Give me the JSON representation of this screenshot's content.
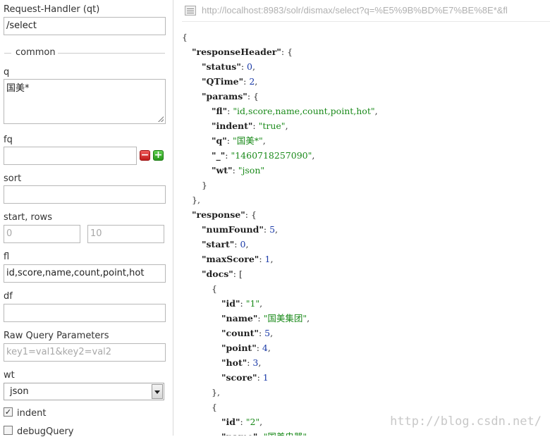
{
  "form": {
    "request_handler": {
      "label": "Request-Handler (qt)",
      "value": "/select"
    },
    "common_legend": "common",
    "q": {
      "label": "q",
      "value": "国美*"
    },
    "fq": {
      "label": "fq",
      "value": ""
    },
    "sort": {
      "label": "sort",
      "value": ""
    },
    "start_rows": {
      "label": "start, rows",
      "start_placeholder": "0",
      "rows_placeholder": "10"
    },
    "fl": {
      "label": "fl",
      "value": "id,score,name,count,point,hot"
    },
    "df": {
      "label": "df",
      "value": ""
    },
    "raw": {
      "label": "Raw Query Parameters",
      "placeholder": "key1=val1&key2=val2"
    },
    "wt": {
      "label": "wt",
      "value": "json"
    },
    "indent": {
      "label": "indent",
      "checked": true
    },
    "debug": {
      "label": "debugQuery",
      "checked": false
    }
  },
  "result": {
    "url": "http://localhost:8983/solr/dismax/select?q=%E5%9B%BD%E7%BE%8E*&fl",
    "lines": [
      {
        "indent": 0,
        "parts": [
          {
            "t": "p",
            "v": "{"
          }
        ]
      },
      {
        "indent": 1,
        "parts": [
          {
            "t": "k",
            "v": "\"responseHeader\""
          },
          {
            "t": "p",
            "v": ": {"
          }
        ]
      },
      {
        "indent": 2,
        "parts": [
          {
            "t": "k",
            "v": "\"status\""
          },
          {
            "t": "p",
            "v": ": "
          },
          {
            "t": "n",
            "v": "0"
          },
          {
            "t": "p",
            "v": ","
          }
        ]
      },
      {
        "indent": 2,
        "parts": [
          {
            "t": "k",
            "v": "\"QTime\""
          },
          {
            "t": "p",
            "v": ": "
          },
          {
            "t": "n",
            "v": "2"
          },
          {
            "t": "p",
            "v": ","
          }
        ]
      },
      {
        "indent": 2,
        "parts": [
          {
            "t": "k",
            "v": "\"params\""
          },
          {
            "t": "p",
            "v": ": {"
          }
        ]
      },
      {
        "indent": 3,
        "parts": [
          {
            "t": "k",
            "v": "\"fl\""
          },
          {
            "t": "p",
            "v": ": "
          },
          {
            "t": "s",
            "v": "\"id,score,name,count,point,hot\""
          },
          {
            "t": "p",
            "v": ","
          }
        ]
      },
      {
        "indent": 3,
        "parts": [
          {
            "t": "k",
            "v": "\"indent\""
          },
          {
            "t": "p",
            "v": ": "
          },
          {
            "t": "s",
            "v": "\"true\""
          },
          {
            "t": "p",
            "v": ","
          }
        ]
      },
      {
        "indent": 3,
        "parts": [
          {
            "t": "k",
            "v": "\"q\""
          },
          {
            "t": "p",
            "v": ": "
          },
          {
            "t": "s",
            "v": "\"国美*\""
          },
          {
            "t": "p",
            "v": ","
          }
        ]
      },
      {
        "indent": 3,
        "parts": [
          {
            "t": "k",
            "v": "\"_\""
          },
          {
            "t": "p",
            "v": ": "
          },
          {
            "t": "s",
            "v": "\"1460718257090\""
          },
          {
            "t": "p",
            "v": ","
          }
        ]
      },
      {
        "indent": 3,
        "parts": [
          {
            "t": "k",
            "v": "\"wt\""
          },
          {
            "t": "p",
            "v": ": "
          },
          {
            "t": "s",
            "v": "\"json\""
          }
        ]
      },
      {
        "indent": 2,
        "parts": [
          {
            "t": "p",
            "v": "}"
          }
        ]
      },
      {
        "indent": 1,
        "parts": [
          {
            "t": "p",
            "v": "},"
          }
        ]
      },
      {
        "indent": 1,
        "parts": [
          {
            "t": "k",
            "v": "\"response\""
          },
          {
            "t": "p",
            "v": ": {"
          }
        ]
      },
      {
        "indent": 2,
        "parts": [
          {
            "t": "k",
            "v": "\"numFound\""
          },
          {
            "t": "p",
            "v": ": "
          },
          {
            "t": "n",
            "v": "5"
          },
          {
            "t": "p",
            "v": ","
          }
        ]
      },
      {
        "indent": 2,
        "parts": [
          {
            "t": "k",
            "v": "\"start\""
          },
          {
            "t": "p",
            "v": ": "
          },
          {
            "t": "n",
            "v": "0"
          },
          {
            "t": "p",
            "v": ","
          }
        ]
      },
      {
        "indent": 2,
        "parts": [
          {
            "t": "k",
            "v": "\"maxScore\""
          },
          {
            "t": "p",
            "v": ": "
          },
          {
            "t": "n",
            "v": "1"
          },
          {
            "t": "p",
            "v": ","
          }
        ]
      },
      {
        "indent": 2,
        "parts": [
          {
            "t": "k",
            "v": "\"docs\""
          },
          {
            "t": "p",
            "v": ": ["
          }
        ]
      },
      {
        "indent": 3,
        "parts": [
          {
            "t": "p",
            "v": "{"
          }
        ]
      },
      {
        "indent": 4,
        "parts": [
          {
            "t": "k",
            "v": "\"id\""
          },
          {
            "t": "p",
            "v": ": "
          },
          {
            "t": "s",
            "v": "\"1\""
          },
          {
            "t": "p",
            "v": ","
          }
        ]
      },
      {
        "indent": 4,
        "parts": [
          {
            "t": "k",
            "v": "\"name\""
          },
          {
            "t": "p",
            "v": ": "
          },
          {
            "t": "s",
            "v": "\"国美集团\""
          },
          {
            "t": "p",
            "v": ","
          }
        ]
      },
      {
        "indent": 4,
        "parts": [
          {
            "t": "k",
            "v": "\"count\""
          },
          {
            "t": "p",
            "v": ": "
          },
          {
            "t": "n",
            "v": "5"
          },
          {
            "t": "p",
            "v": ","
          }
        ]
      },
      {
        "indent": 4,
        "parts": [
          {
            "t": "k",
            "v": "\"point\""
          },
          {
            "t": "p",
            "v": ": "
          },
          {
            "t": "n",
            "v": "4"
          },
          {
            "t": "p",
            "v": ","
          }
        ]
      },
      {
        "indent": 4,
        "parts": [
          {
            "t": "k",
            "v": "\"hot\""
          },
          {
            "t": "p",
            "v": ": "
          },
          {
            "t": "n",
            "v": "3"
          },
          {
            "t": "p",
            "v": ","
          }
        ]
      },
      {
        "indent": 4,
        "parts": [
          {
            "t": "k",
            "v": "\"score\""
          },
          {
            "t": "p",
            "v": ": "
          },
          {
            "t": "n",
            "v": "1"
          }
        ]
      },
      {
        "indent": 3,
        "parts": [
          {
            "t": "p",
            "v": "},"
          }
        ]
      },
      {
        "indent": 3,
        "parts": [
          {
            "t": "p",
            "v": "{"
          }
        ]
      },
      {
        "indent": 4,
        "parts": [
          {
            "t": "k",
            "v": "\"id\""
          },
          {
            "t": "p",
            "v": ": "
          },
          {
            "t": "s",
            "v": "\"2\""
          },
          {
            "t": "p",
            "v": ","
          }
        ]
      },
      {
        "indent": 4,
        "parts": [
          {
            "t": "k",
            "v": "\"name\""
          },
          {
            "t": "p",
            "v": ": "
          },
          {
            "t": "s",
            "v": "\"国美电器\""
          },
          {
            "t": "p",
            "v": ","
          }
        ]
      }
    ]
  },
  "watermark": "http://blog.csdn.net/",
  "colors": {
    "key": "#222222",
    "string": "#1a8a1a",
    "number": "#1a3aa8",
    "border": "#b8b8b8"
  }
}
